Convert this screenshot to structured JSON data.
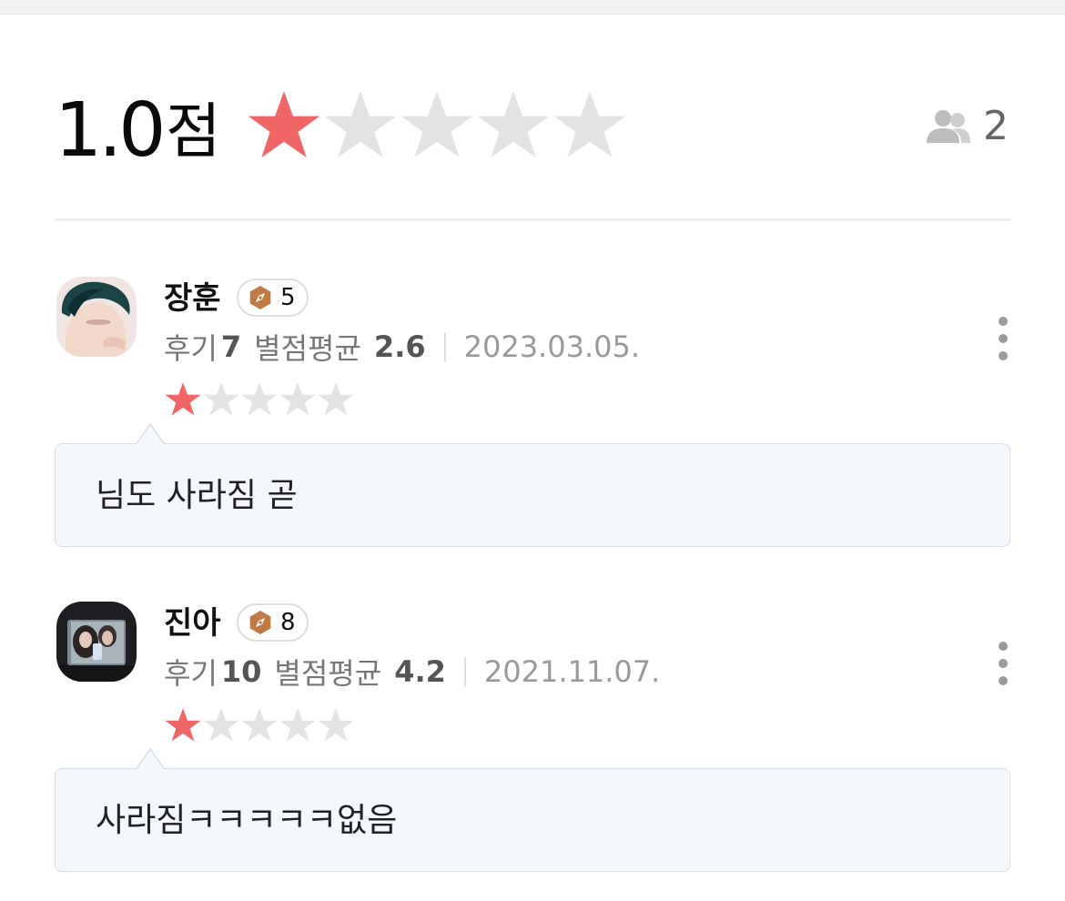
{
  "summary": {
    "score": "1.0",
    "score_unit": "점",
    "rating_stars": 1,
    "max_stars": 5,
    "participant_icon": "people-icon",
    "participant_count": "2"
  },
  "colors": {
    "star_filled": "#f06565",
    "star_empty": "#e3e3e3",
    "badge_hex": "#c07a45",
    "bubble_bg": "#f4f7fb"
  },
  "reviews": [
    {
      "name": "장훈",
      "badge_icon": "hexagon-compass-icon",
      "badge_level": "5",
      "reviews_label": "후기",
      "reviews_count": "7",
      "avg_label": "별점평균",
      "avg_value": "2.6",
      "date": "2023.03.05.",
      "rating_stars": 1,
      "comment": "님도 사라짐 곧"
    },
    {
      "name": "진아",
      "badge_icon": "hexagon-compass-icon",
      "badge_level": "8",
      "reviews_label": "후기",
      "reviews_count": "10",
      "avg_label": "별점평균",
      "avg_value": "4.2",
      "date": "2021.11.07.",
      "rating_stars": 1,
      "comment": "사라짐ㅋㅋㅋㅋㅋ없음"
    }
  ]
}
